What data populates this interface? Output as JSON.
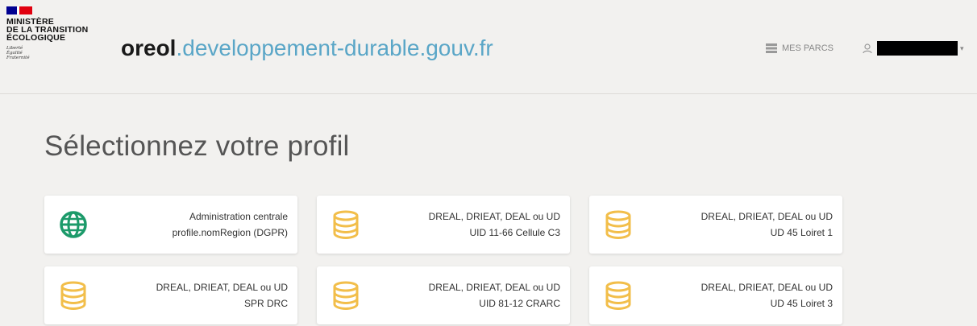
{
  "header": {
    "ministry_lines": [
      "MINISTÈRE",
      "DE LA TRANSITION",
      "ÉCOLOGIQUE"
    ],
    "motto_lines": [
      "Liberté",
      "Égalité",
      "Fraternité"
    ],
    "site_brand": "oreol",
    "site_domain": ".developpement-durable.gouv.fr",
    "nav_parcs_label": "MES PARCS",
    "nav_parcs_icon": "list-icon",
    "user_icon": "user-icon",
    "user_name": "██████████"
  },
  "page_title": "Sélectionnez votre profil",
  "colors": {
    "background": "#f2f1ef",
    "brand_blue": "#5aa6c7",
    "globe_green": "#1c9a6a",
    "coins_yellow": "#f2be4a"
  },
  "profiles": [
    {
      "icon": "globe-icon",
      "line1": "Administration centrale",
      "line2": "profile.nomRegion (DGPR)"
    },
    {
      "icon": "database-icon",
      "line1": "DREAL, DRIEAT, DEAL ou UD",
      "line2": "UID 11-66 Cellule C3"
    },
    {
      "icon": "database-icon",
      "line1": "DREAL, DRIEAT, DEAL ou UD",
      "line2": "UD 45 Loiret 1"
    },
    {
      "icon": "database-icon",
      "line1": "DREAL, DRIEAT, DEAL ou UD",
      "line2": "SPR DRC"
    },
    {
      "icon": "database-icon",
      "line1": "DREAL, DRIEAT, DEAL ou UD",
      "line2": "UID 81-12 CRARC"
    },
    {
      "icon": "database-icon",
      "line1": "DREAL, DRIEAT, DEAL ou UD",
      "line2": "UD 45 Loiret 3"
    }
  ]
}
